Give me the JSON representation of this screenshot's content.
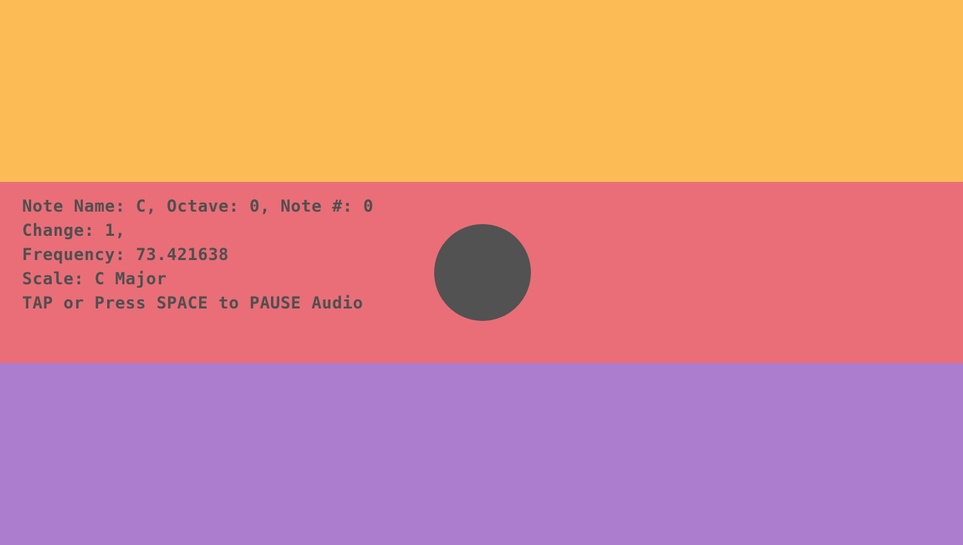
{
  "colors": {
    "top_band": "#FDBB56",
    "middle_band": "#E96E78",
    "bottom_band": "#AC7DCF",
    "ball": "#525252",
    "text": "#4F4F4F"
  },
  "info": {
    "note_line": "Note Name: C, Octave: 0, Note #: 0",
    "change_line": "Change: 1,",
    "frequency_line": "Frequency: 73.421638",
    "scale_line": "Scale: C Major",
    "instruction_line": "TAP or Press SPACE to PAUSE Audio"
  }
}
